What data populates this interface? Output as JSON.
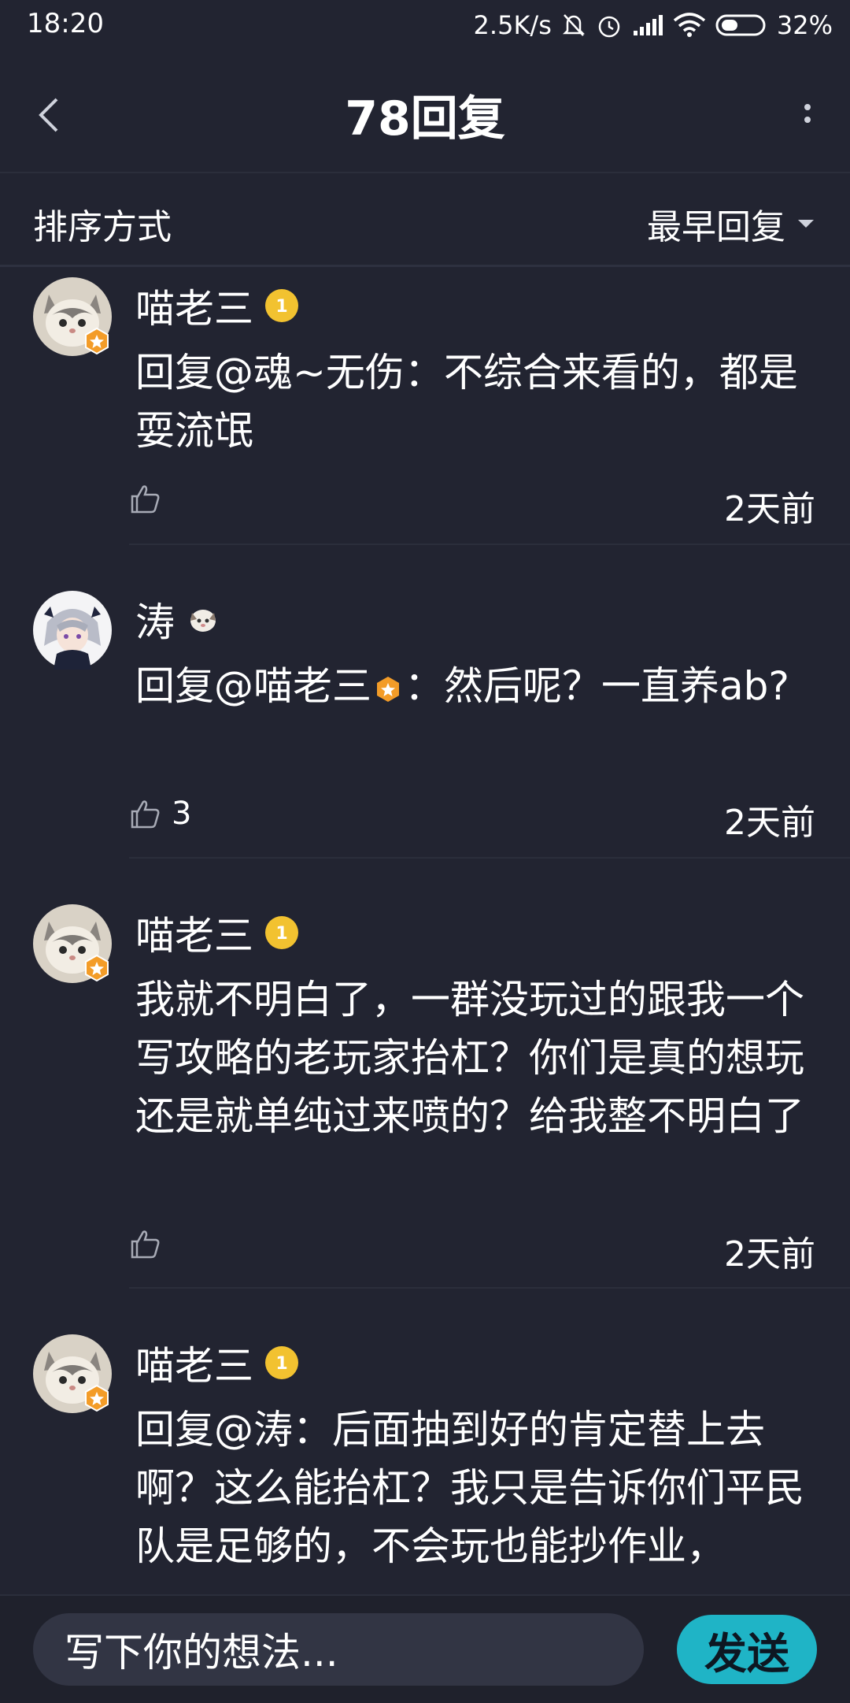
{
  "status_bar": {
    "time": "18:20",
    "network_speed": "2.5K/s",
    "battery": "32%"
  },
  "header": {
    "title": "78回复"
  },
  "sort": {
    "label": "排序方式",
    "selected": "最早回复"
  },
  "comments": [
    {
      "username": "喵老三",
      "text": "回复@魂~无伤：不综合来看的，都是耍流氓",
      "likes": "",
      "time": "2天前"
    },
    {
      "username": "涛",
      "text_prefix": "回复@喵老三",
      "text_suffix": "：然后呢？一直养ab?",
      "likes": "3",
      "time": "2天前"
    },
    {
      "username": "喵老三",
      "text": "我就不明白了，一群没玩过的跟我一个写攻略的老玩家抬杠？你们是真的想玩还是就单纯过来喷的？给我整不明白了",
      "likes": "",
      "time": "2天前"
    },
    {
      "username": "喵老三",
      "text": "回复@涛：后面抽到好的肯定替上去啊？这么能抬杠？我只是告诉你们平民队是足够的，不会玩也能抄作业，"
    }
  ],
  "input": {
    "placeholder": "写下你的想法..."
  },
  "send_label": "发送",
  "colors": {
    "background": "#222431",
    "accent": "#1fb4c6",
    "badge_gold": "#f2c230",
    "badge_orange": "#f39c28"
  }
}
